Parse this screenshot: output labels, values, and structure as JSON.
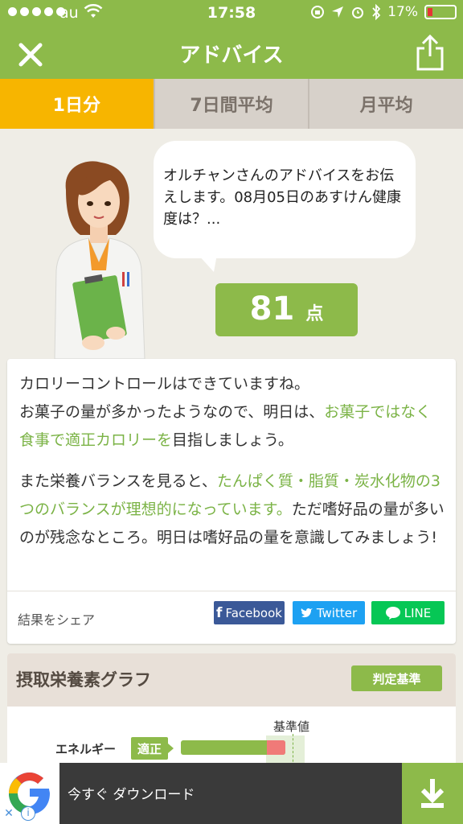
{
  "status_bar": {
    "carrier": "au",
    "time": "17:58",
    "battery_percent": "17%"
  },
  "nav": {
    "title": "アドバイス"
  },
  "tabs": [
    {
      "label": "1日分",
      "active": true
    },
    {
      "label": "7日間平均",
      "active": false
    },
    {
      "label": "月平均",
      "active": false
    }
  ],
  "bubble": {
    "text": "オルチャンさんのアドバイスをお伝えします。08月05日のあすけん健康度は？..."
  },
  "score": {
    "value": "81",
    "unit": "点"
  },
  "advice": {
    "p1_line1": "カロリーコントロールはできていますね。",
    "p1_line2a": "お菓子の量が多かったようなので、明日は、",
    "p1_highlight": "お菓子ではなく食事で適正カロリーを",
    "p1_line2b": "目指しましょう。",
    "p2_a": "また栄養バランスを見ると、",
    "p2_highlight": "たんぱく質・脂質・炭水化物の3つのバランスが理想的になっています。",
    "p2_b": "ただ嗜好品の量が多いのが残念なところ。明日は嗜好品の量を意識してみましょう!"
  },
  "share": {
    "label": "結果をシェア",
    "facebook": "Facebook",
    "twitter": "Twitter",
    "line": "LINE"
  },
  "graph": {
    "title": "摂取栄養素グラフ",
    "criteria_button": "判定基準",
    "reference_label": "基準値",
    "rows": [
      {
        "label": "エネルギー",
        "judgement": "適正"
      }
    ]
  },
  "ad": {
    "text": "今すぐ ダウンロード"
  },
  "colors": {
    "brand_green": "#8dba4a",
    "tab_active": "#f7b500",
    "highlight_text": "#7bb346",
    "over_bar": "#f07a78"
  }
}
